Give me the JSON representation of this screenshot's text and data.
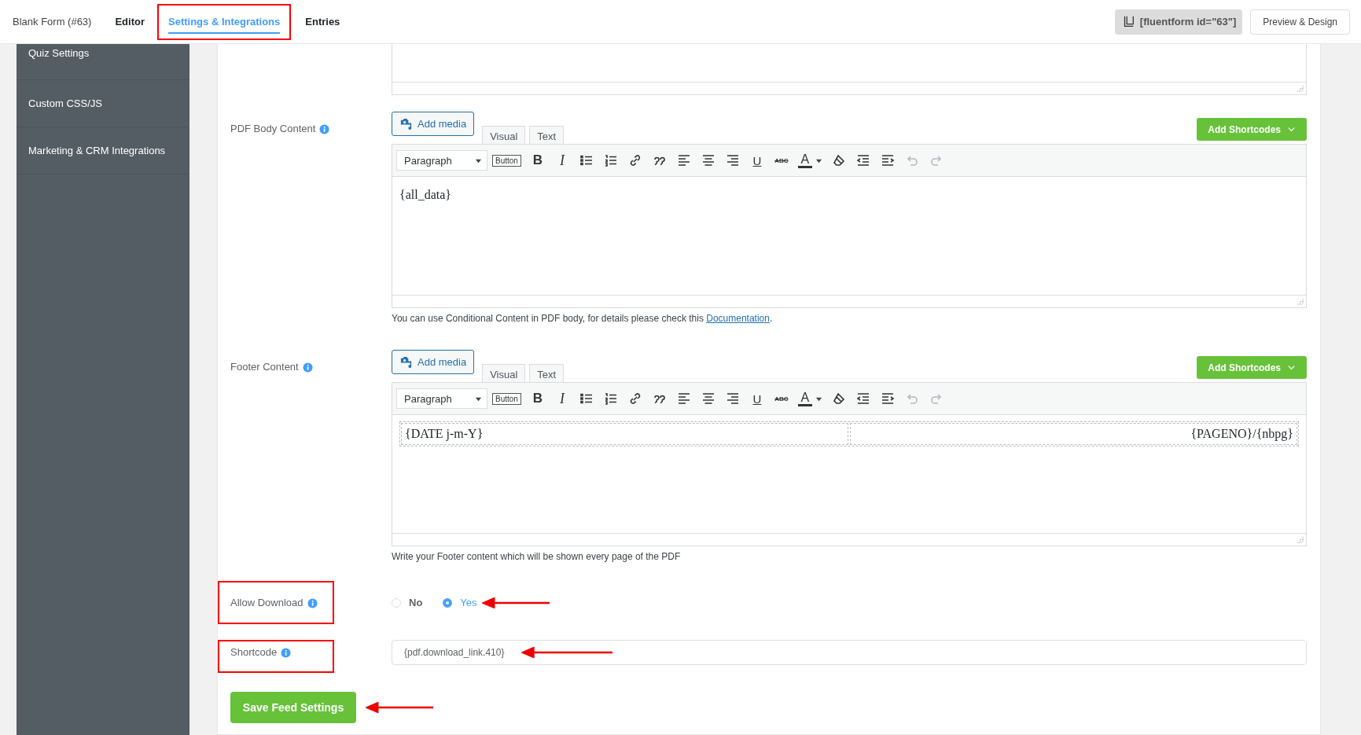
{
  "header": {
    "form_name": "Blank Form (#63)",
    "tabs": [
      {
        "label": "Editor",
        "selected": false,
        "highlighted": false
      },
      {
        "label": "Settings & Integrations",
        "selected": true,
        "highlighted": true
      },
      {
        "label": "Entries",
        "selected": false,
        "highlighted": false
      }
    ],
    "shortcode_badge": "[fluentform id=\"63\"]",
    "preview_button": "Preview & Design"
  },
  "sidebar": {
    "items": [
      {
        "label": "Quiz Settings"
      },
      {
        "label": "Custom CSS/JS"
      },
      {
        "label": "Marketing & CRM Integrations"
      }
    ]
  },
  "editors": [
    {
      "label": "PDF Body Content",
      "media_button": "Add media",
      "modes": [
        {
          "label": "Visual",
          "selected": false
        },
        {
          "label": "Text",
          "selected": false
        }
      ],
      "shortcodes_button": "Add Shortcodes",
      "toolbar": [
        {
          "kind": "select",
          "label": "Paragraph",
          "disabled": false
        },
        {
          "kind": "tag",
          "label": "Button",
          "disabled": false
        },
        {
          "kind": "bold",
          "label": "B",
          "disabled": false
        },
        {
          "kind": "italic",
          "label": "I",
          "disabled": false
        },
        {
          "kind": "bullets",
          "disabled": false
        },
        {
          "kind": "numbers",
          "disabled": false
        },
        {
          "kind": "link",
          "disabled": false
        },
        {
          "kind": "quote",
          "disabled": false
        },
        {
          "kind": "align-left",
          "disabled": false
        },
        {
          "kind": "align-center",
          "disabled": false
        },
        {
          "kind": "align-right",
          "disabled": false
        },
        {
          "kind": "underline",
          "label": "U",
          "disabled": false
        },
        {
          "kind": "strike",
          "label": "ABC",
          "disabled": false
        },
        {
          "kind": "color",
          "label": "A",
          "disabled": false
        },
        {
          "kind": "eraser",
          "disabled": false
        },
        {
          "kind": "outdent",
          "disabled": false
        },
        {
          "kind": "indent",
          "disabled": false
        },
        {
          "kind": "undo",
          "disabled": true
        },
        {
          "kind": "redo",
          "disabled": true
        }
      ],
      "content": {
        "kind": "text",
        "text": "{all_data}"
      },
      "help": {
        "before": "You can use Conditional Content in PDF body, for details please check this ",
        "link": "Documentation",
        "after": "."
      }
    },
    {
      "label": "Footer Content",
      "media_button": "Add media",
      "modes": [
        {
          "label": "Visual",
          "selected": false
        },
        {
          "label": "Text",
          "selected": false
        }
      ],
      "shortcodes_button": "Add Shortcodes",
      "toolbar": [
        {
          "kind": "select",
          "label": "Paragraph",
          "disabled": false
        },
        {
          "kind": "tag",
          "label": "Button",
          "disabled": false
        },
        {
          "kind": "bold",
          "label": "B",
          "disabled": false
        },
        {
          "kind": "italic",
          "label": "I",
          "disabled": false
        },
        {
          "kind": "bullets",
          "disabled": false
        },
        {
          "kind": "numbers",
          "disabled": false
        },
        {
          "kind": "link",
          "disabled": false
        },
        {
          "kind": "quote",
          "disabled": false
        },
        {
          "kind": "align-left",
          "disabled": false
        },
        {
          "kind": "align-center",
          "disabled": false
        },
        {
          "kind": "align-right",
          "disabled": false
        },
        {
          "kind": "underline",
          "label": "U",
          "disabled": false
        },
        {
          "kind": "strike",
          "label": "ABC",
          "disabled": false
        },
        {
          "kind": "color",
          "label": "A",
          "disabled": false
        },
        {
          "kind": "eraser",
          "disabled": false
        },
        {
          "kind": "outdent",
          "disabled": false
        },
        {
          "kind": "indent",
          "disabled": false
        },
        {
          "kind": "undo",
          "disabled": true
        },
        {
          "kind": "redo",
          "disabled": true
        }
      ],
      "content": {
        "kind": "table",
        "cells": [
          "{DATE j-m-Y}",
          "{PAGENO}/{nbpg}"
        ]
      },
      "help": {
        "before": "Write your Footer content which will be shown every page of the PDF"
      }
    }
  ],
  "allow_download": {
    "label": "Allow Download",
    "highlighted": true,
    "arrow": true,
    "options": [
      {
        "label": "No",
        "selected": false
      },
      {
        "label": "Yes",
        "selected": true
      }
    ]
  },
  "shortcode": {
    "label": "Shortcode",
    "highlighted": true,
    "arrow": true,
    "value": "{pdf.download_link.410}"
  },
  "save_button": {
    "label": "Save Feed Settings",
    "arrow": true
  }
}
